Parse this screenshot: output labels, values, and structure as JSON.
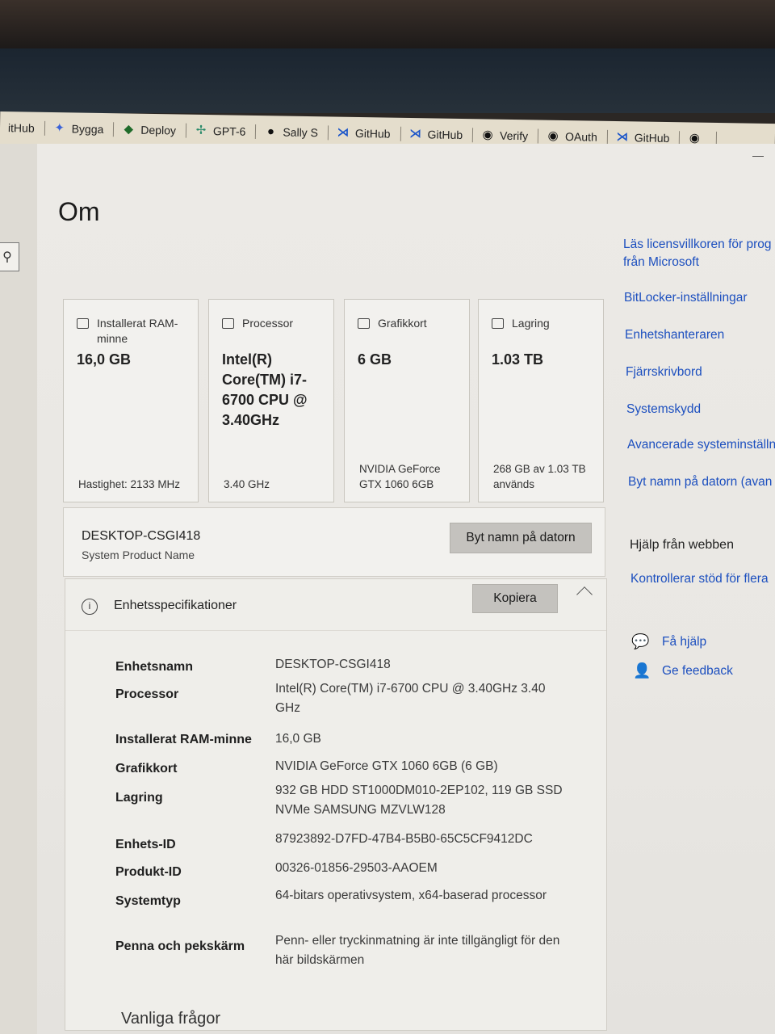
{
  "bookmarks": [
    {
      "label": "itHub",
      "icon": "github-icon"
    },
    {
      "label": "Bygga",
      "icon": "gemini-icon"
    },
    {
      "label": "Deploy",
      "icon": "deploy-icon"
    },
    {
      "label": "GPT-6",
      "icon": "gpt-icon"
    },
    {
      "label": "Sally S",
      "icon": "globe-icon"
    },
    {
      "label": "GitHub",
      "icon": "vscode-icon"
    },
    {
      "label": "GitHub",
      "icon": "vscode-icon"
    },
    {
      "label": "Verify",
      "icon": "github-icon"
    },
    {
      "label": "OAuth",
      "icon": "github-icon"
    },
    {
      "label": "GitHub",
      "icon": "vscode-icon"
    }
  ],
  "window": {
    "minimize": "—",
    "title": "Om"
  },
  "cards": [
    {
      "title": "Installerat RAM-minne",
      "value": "16,0 GB",
      "sub": "Hastighet: 2133 MHz"
    },
    {
      "title": "Processor",
      "value": "Intel(R) Core(TM) i7-6700 CPU @ 3.40GHz",
      "sub": "3.40 GHz"
    },
    {
      "title": "Grafikkort",
      "value": "6 GB",
      "sub": "NVIDIA GeForce GTX 1060 6GB"
    },
    {
      "title": "Lagring",
      "value": "1.03 TB",
      "sub": "268 GB av 1.03 TB används"
    }
  ],
  "device": {
    "name": "DESKTOP-CSGI418",
    "model": "System Product Name",
    "rename_button": "Byt namn på datorn"
  },
  "specs": {
    "title": "Enhetsspecifikationer",
    "copy_button": "Kopiera",
    "rows": [
      {
        "label": "Enhetsnamn",
        "value": "DESKTOP-CSGI418"
      },
      {
        "label": "Processor",
        "value": "Intel(R) Core(TM) i7-6700 CPU @ 3.40GHz   3.40 GHz"
      },
      {
        "label": "Installerat RAM-minne",
        "value": "16,0 GB"
      },
      {
        "label": "Grafikkort",
        "value": "NVIDIA GeForce GTX 1060 6GB (6 GB)"
      },
      {
        "label": "Lagring",
        "value": "932 GB HDD ST1000DM010-2EP102, 119 GB SSD NVMe SAMSUNG MZVLW128"
      },
      {
        "label": "Enhets-ID",
        "value": "87923892-D7FD-47B4-B5B0-65C5CF9412DC"
      },
      {
        "label": "Produkt-ID",
        "value": "00326-01856-29503-AAOEM"
      },
      {
        "label": "Systemtyp",
        "value": "64-bitars operativsystem, x64-baserad processor"
      },
      {
        "label": "Penna och pekskärm",
        "value": "Penn- eller tryckinmatning är inte tillgängligt för den här bildskärmen"
      }
    ]
  },
  "faq": "Vanliga frågor",
  "related": {
    "license_link": "Läs licensvillkoren för prog från Microsoft",
    "links": [
      "BitLocker-inställningar",
      "Enhetshanteraren",
      "Fjärrskrivbord",
      "Systemskydd",
      "Avancerade systeminställn",
      "Byt namn på datorn (avan"
    ],
    "web_help_title": "Hjälp från webben",
    "web_help_link": "Kontrollerar stöd för flera",
    "get_help": "Få hjälp",
    "feedback": "Ge feedback"
  }
}
